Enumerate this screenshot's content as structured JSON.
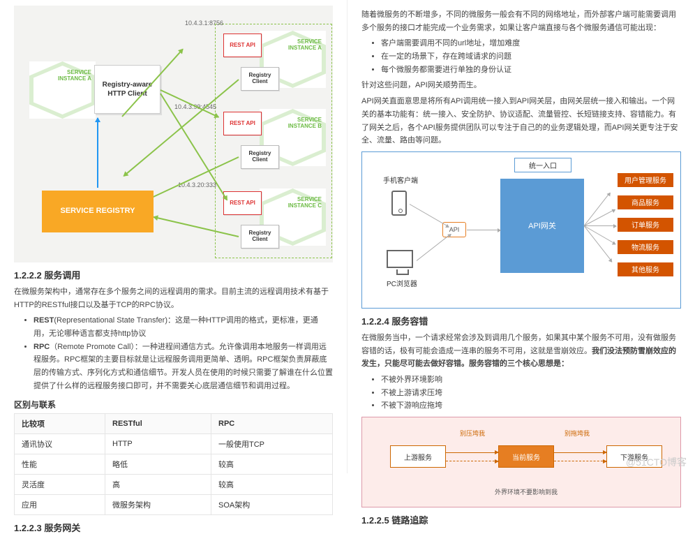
{
  "left": {
    "diagram1": {
      "httpClient": "Registry-aware HTTP Client",
      "serviceRegistry": "SERVICE REGISTRY",
      "instanceFrameLabel": "SERVICE",
      "instances": {
        "a": {
          "label": "SERVICE",
          "sub": "INSTANCE A"
        },
        "b": {
          "label": "SERVICE",
          "sub": "INSTANCE B",
          "ip": "10.4.3.99:4545"
        },
        "c": {
          "label": "SERVICE",
          "sub": "INSTANCE C",
          "ip": "10.4.3.20:333"
        },
        "top": {
          "ip": "10.4.3.1:8756"
        }
      },
      "restApi": "REST API",
      "registryClient": "Registry Client"
    },
    "h1": "1.2.2.2 服务调用",
    "p1": "在微服务架构中，通常存在多个服务之间的远程调用的需求。目前主流的远程调用技术有基于HTTP的RESTful接口以及基于TCP的RPC协议。",
    "bullets": [
      "REST(Representational State Transfer)：这是一种HTTP调用的格式，更标准，更通用，无论哪种语言都支持http协议",
      "RPC（Remote Promote Call）：一种进程间通信方式。允许像调用本地服务一样调用远程服务。RPC框架的主要目标就是让远程服务调用更简单、透明。RPC框架负责屏蔽底层的传输方式、序列化方式和通信细节。开发人员在使用的时候只需要了解谁在什么位置提供了什么样的远程服务接口即可，并不需要关心底层通信细节和调用过程。"
    ],
    "bulletHeads": [
      "REST",
      "RPC"
    ],
    "subhead": "区别与联系",
    "table": {
      "headers": [
        "比较项",
        "RESTful",
        "RPC"
      ],
      "rows": [
        [
          "通讯协议",
          "HTTP",
          "一般使用TCP"
        ],
        [
          "性能",
          "略低",
          "较高"
        ],
        [
          "灵活度",
          "高",
          "较高"
        ],
        [
          "应用",
          "微服务架构",
          "SOA架构"
        ]
      ]
    },
    "h2": "1.2.2.3 服务网关"
  },
  "right": {
    "p0": "随着微服务的不断增多，不同的微服务一般会有不同的网络地址，而外部客户端可能需要调用多个服务的接口才能完成一个业务需求，如果让客户端直接与各个微服务通信可能出现：",
    "bullets1": [
      "客户端需要调用不同的url地址，增加难度",
      "在一定的场景下，存在跨域请求的问题",
      "每个微服务都需要进行单独的身份认证"
    ],
    "p1": "针对这些问题，API网关顺势而生。",
    "p2": "API网关直面意思是将所有API调用统一接入到API网关层，由网关层统一接入和输出。一个网关的基本功能有：统一接入、安全防护、协议适配、流量管控、长短链接支持、容错能力。有了网关之后，各个API服务提供团队可以专注于自己的的业务逻辑处理，而API网关更专注于安全、流量、路由等问题。",
    "gw": {
      "entry": "统一入口",
      "gateway": "API网关",
      "phoneLabel": "手机客户端",
      "pcLabel": "PC浏览器",
      "api": "API",
      "services": [
        "用户管理服务",
        "商品服务",
        "订单服务",
        "物流服务",
        "其他服务"
      ]
    },
    "h1": "1.2.2.4 服务容错",
    "p3a": "在微服务当中，一个请求经常会涉及到调用几个服务，如果其中某个服务不可用，没有做服务容错的话，极有可能会造成一连串的服务不可用，这就是雪崩效应。",
    "p3b": "我们没法预防雪崩效应的发生，只能尽可能去做好容错。服务容错的三个核心思想是：",
    "bullets2": [
      "不被外界环境影响",
      "不被上游请求压垮",
      "不被下游响应拖垮"
    ],
    "ft": {
      "up": "上游服务",
      "mid": "当前服务",
      "down": "下游服务",
      "l1": "别压垮我",
      "l2": "别拖垮我",
      "note": "外界环境不要影响到我"
    },
    "h2": "1.2.2.5 链路追踪"
  },
  "watermark": "@51CTO博客"
}
